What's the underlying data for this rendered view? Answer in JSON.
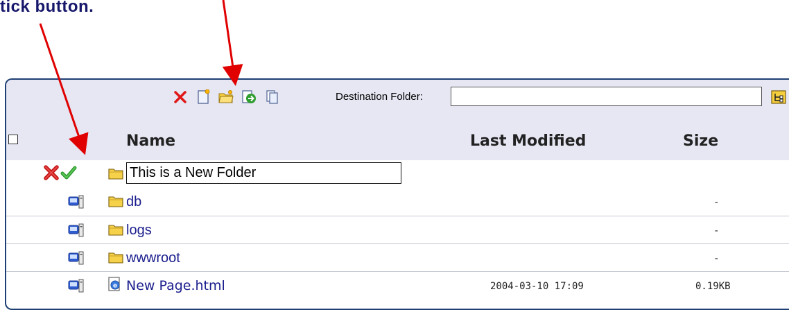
{
  "caption": "tick button.",
  "toolbar": {
    "icons": [
      "delete-x-icon",
      "new-file-icon",
      "new-folder-icon",
      "move-icon",
      "copy-icon"
    ],
    "destination_label": "Destination Folder:",
    "destination_value": "",
    "browse_icon": "folder-tree-icon"
  },
  "columns": {
    "name": "Name",
    "last_modified": "Last Modified",
    "size": "Size"
  },
  "new_folder_row": {
    "cancel_icon": "red-x-icon",
    "confirm_icon": "green-tick-icon",
    "folder_icon": "folder-icon",
    "value": "This is a New Folder"
  },
  "files": [
    {
      "name": "db",
      "type": "folder",
      "modified": "",
      "size": "-"
    },
    {
      "name": "logs",
      "type": "folder",
      "modified": "",
      "size": "-"
    },
    {
      "name": "wwwroot",
      "type": "folder",
      "modified": "",
      "size": "-"
    },
    {
      "name": "New Page.html",
      "type": "page",
      "modified": "2004-03-10 17:09",
      "size": "0.19KB"
    }
  ],
  "colors": {
    "panel_border": "#1e3f73",
    "header_bg": "#e6e7f3",
    "link": "#1a1d8c",
    "caption": "#17176b",
    "arrow": "#e00000"
  }
}
